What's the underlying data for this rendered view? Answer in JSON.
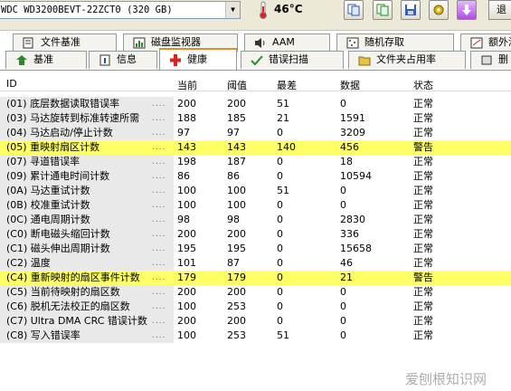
{
  "toolbar": {
    "drive": "WDC WD3200BEVT-22ZCT0 (320 GB)",
    "temperature": "46°C",
    "exit_label": "退"
  },
  "tabs_row1": [
    {
      "label": "文件基准",
      "icon": "file-benchmark-icon"
    },
    {
      "label": "磁盘监视器",
      "icon": "disk-monitor-icon"
    },
    {
      "label": "AAM",
      "icon": "speaker-icon"
    },
    {
      "label": "随机存取",
      "icon": "random-access-icon"
    },
    {
      "label": "额外测试",
      "icon": "extra-tests-icon"
    }
  ],
  "tabs_row2": [
    {
      "label": "基准",
      "icon": "benchmark-icon"
    },
    {
      "label": "信息",
      "icon": "info-icon"
    },
    {
      "label": "健康",
      "icon": "health-cross-icon",
      "active": true
    },
    {
      "label": "错误扫描",
      "icon": "error-scan-icon"
    },
    {
      "label": "文件夹占用率",
      "icon": "folder-usage-icon"
    },
    {
      "label": "删",
      "icon": "erase-icon"
    }
  ],
  "table": {
    "columns": [
      "ID",
      "当前",
      "阈值",
      "最差",
      "数据",
      "状态"
    ],
    "rows": [
      {
        "id": "(01) 底层数据读取错误率",
        "cur": "200",
        "thr": "200",
        "wst": "51",
        "raw": "0",
        "status": "正常"
      },
      {
        "id": "(03) 马达旋转到标准转速所需",
        "cur": "188",
        "thr": "185",
        "wst": "21",
        "raw": "1591",
        "status": "正常"
      },
      {
        "id": "(04) 马达启动/停止计数",
        "cur": "97",
        "thr": "97",
        "wst": "0",
        "raw": "3209",
        "status": "正常"
      },
      {
        "id": "(05) 重映射扇区计数",
        "cur": "143",
        "thr": "143",
        "wst": "140",
        "raw": "456",
        "status": "警告",
        "warn": true
      },
      {
        "id": "(07) 寻道错误率",
        "cur": "198",
        "thr": "187",
        "wst": "0",
        "raw": "18",
        "status": "正常"
      },
      {
        "id": "(09) 累计通电时间计数",
        "cur": "86",
        "thr": "86",
        "wst": "0",
        "raw": "10594",
        "status": "正常"
      },
      {
        "id": "(0A) 马达重试计数",
        "cur": "100",
        "thr": "100",
        "wst": "51",
        "raw": "0",
        "status": "正常"
      },
      {
        "id": "(0B) 校准重试计数",
        "cur": "100",
        "thr": "100",
        "wst": "0",
        "raw": "0",
        "status": "正常"
      },
      {
        "id": "(0C) 通电周期计数",
        "cur": "98",
        "thr": "98",
        "wst": "0",
        "raw": "2830",
        "status": "正常"
      },
      {
        "id": "(C0) 断电磁头缩回计数",
        "cur": "200",
        "thr": "200",
        "wst": "0",
        "raw": "336",
        "status": "正常"
      },
      {
        "id": "(C1) 磁头伸出周期计数",
        "cur": "195",
        "thr": "195",
        "wst": "0",
        "raw": "15658",
        "status": "正常"
      },
      {
        "id": "(C2) 温度",
        "cur": "101",
        "thr": "87",
        "wst": "0",
        "raw": "46",
        "status": "正常"
      },
      {
        "id": "(C4) 重新映射的扇区事件计数",
        "cur": "179",
        "thr": "179",
        "wst": "0",
        "raw": "21",
        "status": "警告",
        "warn": true
      },
      {
        "id": "(C5) 当前待映射的扇区数",
        "cur": "200",
        "thr": "200",
        "wst": "0",
        "raw": "0",
        "status": "正常"
      },
      {
        "id": "(C6) 脱机无法校正的扇区数",
        "cur": "100",
        "thr": "253",
        "wst": "0",
        "raw": "0",
        "status": "正常"
      },
      {
        "id": "(C7) Ultra DMA CRC 错误计数",
        "cur": "200",
        "thr": "200",
        "wst": "0",
        "raw": "0",
        "status": "正常"
      },
      {
        "id": "(C8) 写入错误率",
        "cur": "100",
        "thr": "253",
        "wst": "51",
        "raw": "0",
        "status": "正常"
      }
    ]
  },
  "watermark": "爱刨根知识网"
}
